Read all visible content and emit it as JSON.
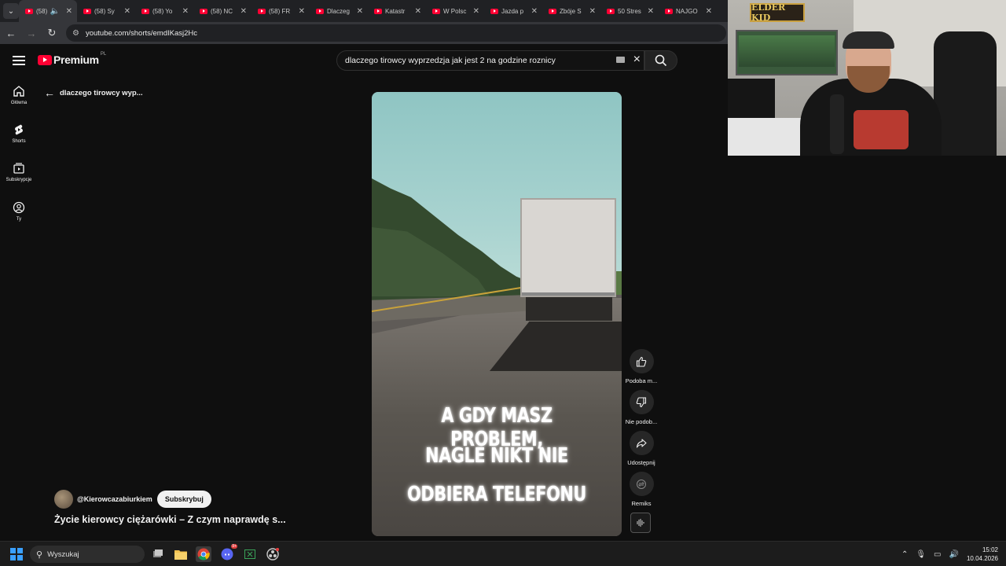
{
  "browser": {
    "tabs": [
      {
        "title": "(58)",
        "active": true,
        "audio": true
      },
      {
        "title": "(58) Sy"
      },
      {
        "title": "(58) Yo"
      },
      {
        "title": "(58) NC"
      },
      {
        "title": "(58) FR"
      },
      {
        "title": "Dlaczeg"
      },
      {
        "title": "Katastr"
      },
      {
        "title": "W Polsc"
      },
      {
        "title": "Jazda p"
      },
      {
        "title": "Zbóje S"
      },
      {
        "title": "50 Stres"
      },
      {
        "title": "NAJGO"
      }
    ],
    "url": "youtube.com/shorts/emdIKasj2Hc"
  },
  "youtube": {
    "logo_text": "Premium",
    "region": "PL",
    "search_value": "dlaczego tirowcy wyprzedzja jak jest 2 na godzine roznicy",
    "guide": [
      {
        "label": "Główna",
        "icon": "home-icon"
      },
      {
        "label": "Shorts",
        "icon": "shorts-icon"
      },
      {
        "label": "Subskrypcje",
        "icon": "subscriptions-icon"
      },
      {
        "label": "Ty",
        "icon": "you-icon"
      }
    ],
    "back_title": "dlaczego tirowcy wyp...",
    "short": {
      "caption_lines": [
        "A GDY MASZ PROBLEM,",
        "NAGLE NIKT NIE",
        "ODBIERA TELEFONU"
      ]
    },
    "actions": [
      {
        "label": "Podoba m...",
        "icon": "thumb-up-icon"
      },
      {
        "label": "Nie podob...",
        "icon": "thumb-down-icon"
      },
      {
        "label": "Udostępnij",
        "icon": "share-icon"
      },
      {
        "label": "Remiks",
        "icon": "remix-icon"
      }
    ],
    "channel": {
      "handle": "@Kierowcazabiurkiem",
      "subscribe_label": "Subskrybuj"
    },
    "video_title": "Życie kierowcy ciężarówki – Z czym naprawdę s..."
  },
  "webcam": {
    "sign_text": "ELDER KID"
  },
  "taskbar": {
    "search_placeholder": "Wyszukaj",
    "discord_badge": "9+",
    "time": "15:02",
    "date": "10.04.2026"
  }
}
